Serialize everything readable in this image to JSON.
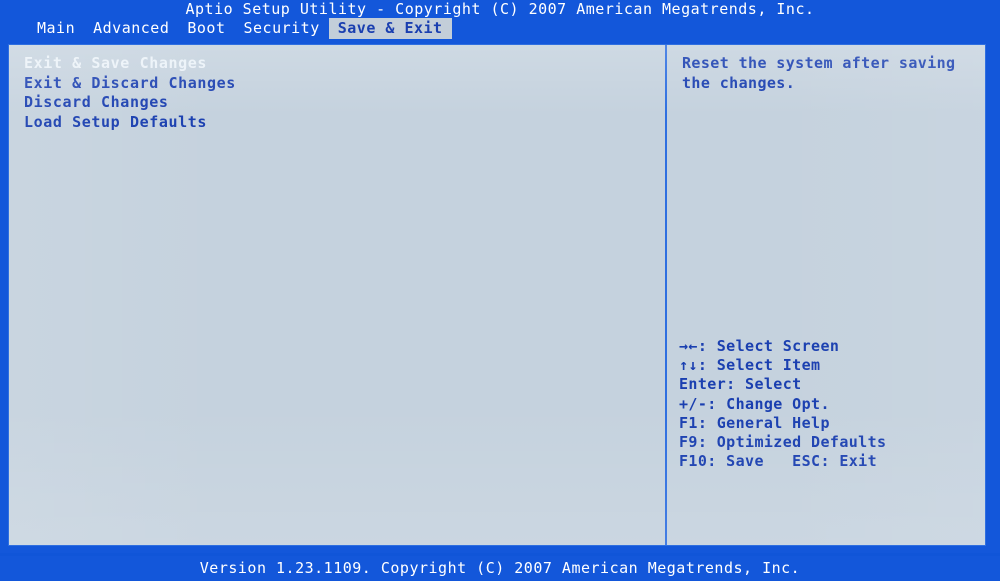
{
  "title_bar": {
    "text": "Aptio Setup Utility - Copyright (C) 2007 American Megatrends, Inc."
  },
  "menu_bar": {
    "tabs": [
      {
        "label": "Main",
        "active": false
      },
      {
        "label": "Advanced",
        "active": false
      },
      {
        "label": "Boot",
        "active": false
      },
      {
        "label": "Security",
        "active": false
      },
      {
        "label": "Save & Exit",
        "active": true
      }
    ]
  },
  "settings_list": {
    "items": [
      {
        "label": "Exit & Save Changes",
        "selected": true
      },
      {
        "label": "Exit & Discard Changes",
        "selected": false
      },
      {
        "label": "Discard Changes",
        "selected": false
      },
      {
        "label": "Load Setup Defaults",
        "selected": false
      }
    ]
  },
  "help_pane": {
    "description_lines": [
      "Reset the system after saving",
      "the changes."
    ],
    "key_legend": [
      "→←: Select Screen",
      "↑↓: Select Item",
      "Enter: Select",
      "+/-: Change Opt.",
      "F1: General Help",
      "F9: Optimized Defaults",
      "F10: Save   ESC: Exit"
    ]
  },
  "footer_bar": {
    "text": "Version 1.23.1109. Copyright (C) 2007 American Megatrends, Inc."
  },
  "colors": {
    "header_blue": "#1357da",
    "panel_background": "#c5d2de",
    "text_blue": "#1a3fb0",
    "selected_text": "#ebf2f8",
    "tab_highlight": "#c3ced9",
    "border_blue": "#2f6fe0"
  }
}
